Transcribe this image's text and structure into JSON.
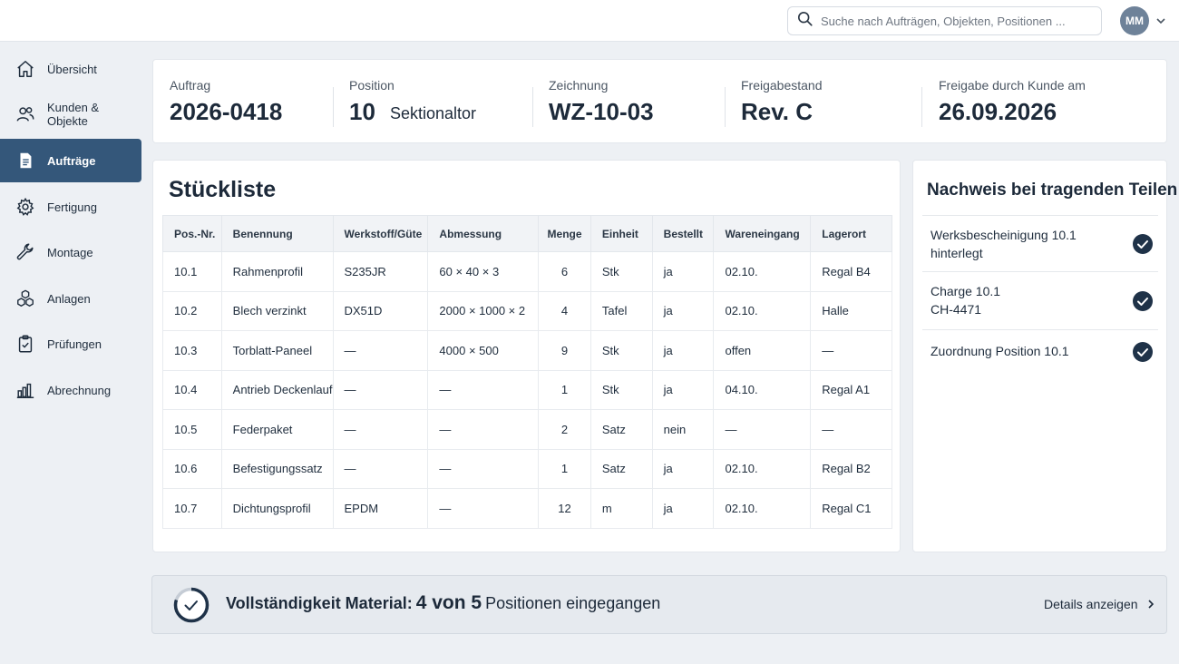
{
  "search": {
    "placeholder": "Suche nach Aufträgen, Objekten, Positionen ..."
  },
  "user": {
    "initials": "MM"
  },
  "sidebar": {
    "items": [
      {
        "label": "Übersicht",
        "icon": "home-icon"
      },
      {
        "label": "Kunden & Objekte",
        "icon": "users-icon"
      },
      {
        "label": "Aufträge",
        "icon": "document-icon",
        "active": true
      },
      {
        "label": "Fertigung",
        "icon": "gear-icon"
      },
      {
        "label": "Montage",
        "icon": "wrench-icon"
      },
      {
        "label": "Anlagen",
        "icon": "cubes-icon"
      },
      {
        "label": "Prüfungen",
        "icon": "clipboard-check-icon"
      },
      {
        "label": "Abrechnung",
        "icon": "bar-chart-icon"
      }
    ]
  },
  "header": {
    "auftrag": {
      "label": "Auftrag",
      "value": "2026-0418"
    },
    "position": {
      "label": "Position",
      "value": "10",
      "sub": "Sektionaltor"
    },
    "zeichnung": {
      "label": "Zeichnung",
      "value": "WZ-10-03"
    },
    "freigabestand": {
      "label": "Freigabestand",
      "value": "Rev. C"
    },
    "freigabe": {
      "label": "Freigabe durch Kunde am",
      "value": "26.09.2026"
    }
  },
  "bom": {
    "title": "Stückliste",
    "columns": [
      "Pos.-Nr.",
      "Benennung",
      "Werkstoff/Güte",
      "Abmessung",
      "Menge",
      "Einheit",
      "Bestellt",
      "Wareneingang",
      "Lagerort"
    ],
    "rows": [
      [
        "10.1",
        "Rahmenprofil",
        "S235JR",
        "60 × 40 × 3",
        "6",
        "Stk",
        "ja",
        "02.10.",
        "Regal B4"
      ],
      [
        "10.2",
        "Blech verzinkt",
        "DX51D",
        "2000 × 1000 × 2",
        "4",
        "Tafel",
        "ja",
        "02.10.",
        "Halle"
      ],
      [
        "10.3",
        "Torblatt-Paneel",
        "—",
        "4000 × 500",
        "9",
        "Stk",
        "ja",
        "offen",
        "—"
      ],
      [
        "10.4",
        "Antrieb Deckenlauf",
        "—",
        "—",
        "1",
        "Stk",
        "ja",
        "04.10.",
        "Regal A1"
      ],
      [
        "10.5",
        "Federpaket",
        "—",
        "—",
        "2",
        "Satz",
        "nein",
        "—",
        "—"
      ],
      [
        "10.6",
        "Befestigungssatz",
        "—",
        "—",
        "1",
        "Satz",
        "ja",
        "02.10.",
        "Regal B2"
      ],
      [
        "10.7",
        "Dichtungsprofil",
        "EPDM",
        "—",
        "12",
        "m",
        "ja",
        "02.10.",
        "Regal C1"
      ]
    ]
  },
  "proof": {
    "title": "Nachweis bei tragenden Teilen",
    "items": [
      {
        "line1": "Werksbescheinigung 10.1",
        "line2": "hinterlegt",
        "checked": true
      },
      {
        "line1": "Charge 10.1",
        "line2": "CH-4471",
        "checked": true
      },
      {
        "line1": "Zuordnung Position 10.1",
        "line2": "",
        "checked": true
      }
    ]
  },
  "status": {
    "label": "Vollständigkeit Material:",
    "count": "4 von 5",
    "rest": "Positionen eingegangen",
    "received": 4,
    "total": 5,
    "details_label": "Details anzeigen"
  }
}
